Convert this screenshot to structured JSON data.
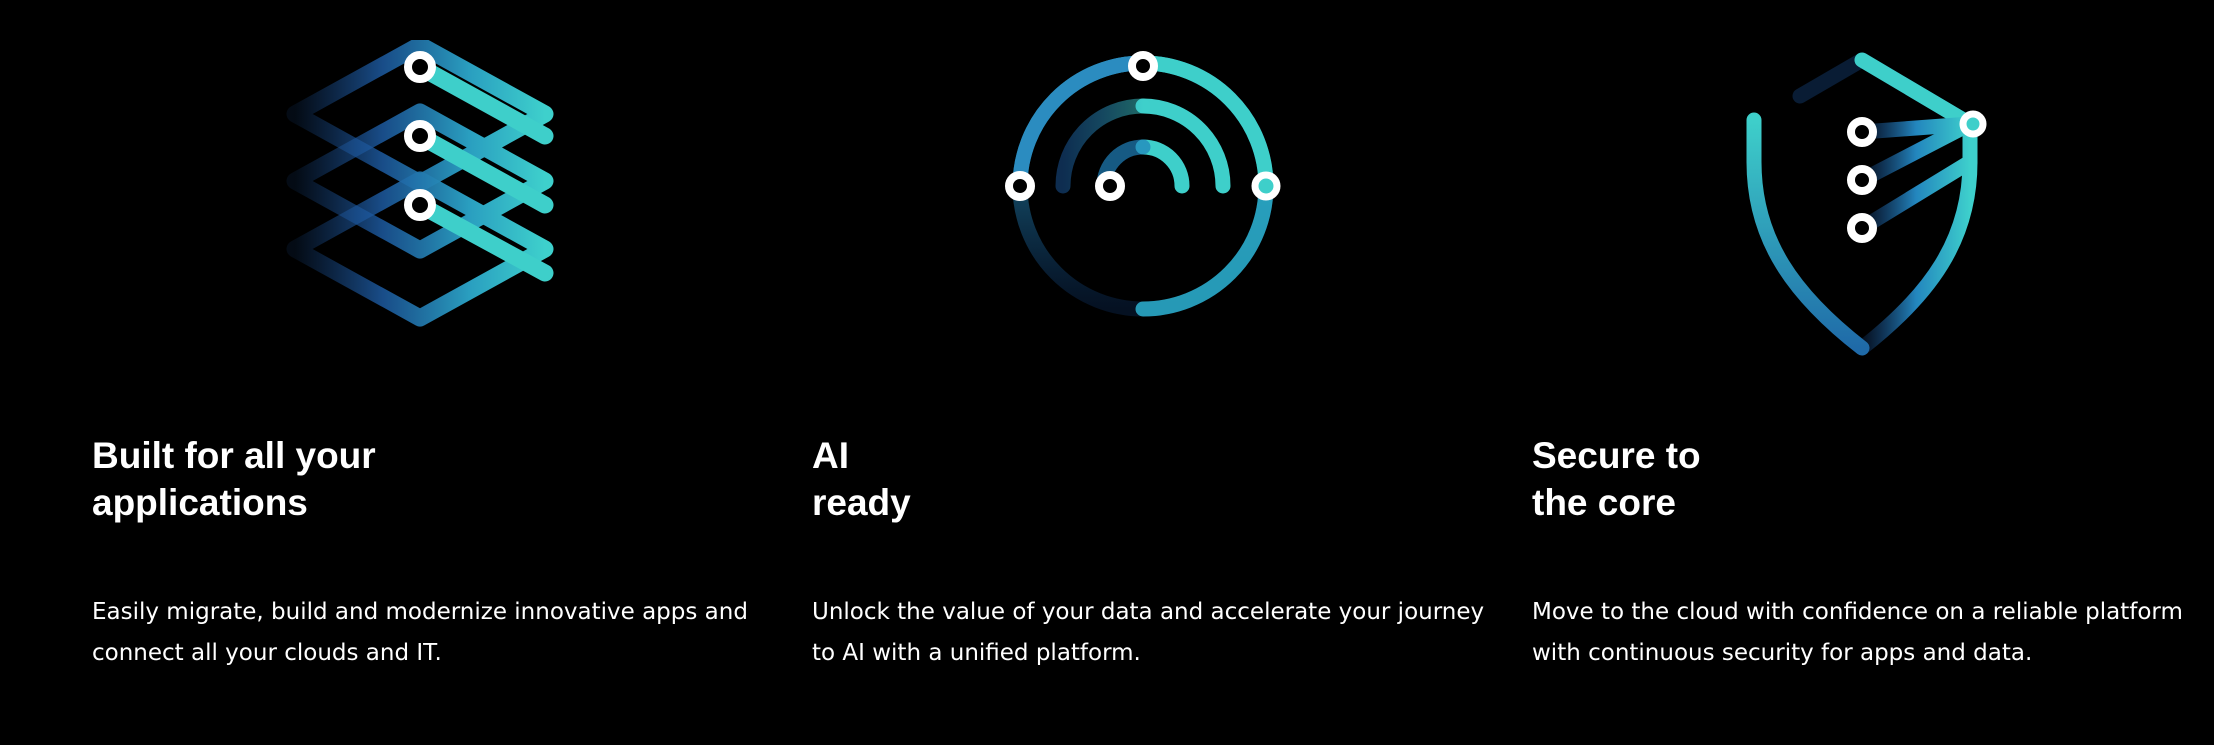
{
  "colors": {
    "background": "#000000",
    "text": "#ffffff",
    "accent_teal": "#3ccfcf",
    "accent_blue": "#1f5fa8"
  },
  "features": [
    {
      "icon": "stacked-layers-icon",
      "title_lines": [
        "Built for all your",
        "applications"
      ],
      "description_lines": [
        "Easily migrate, build and modernize innovative apps and",
        "connect all your clouds and IT."
      ]
    },
    {
      "icon": "concentric-arcs-icon",
      "title_lines": [
        "AI",
        "ready"
      ],
      "description_lines": [
        "Unlock the value of your data and accelerate your journey",
        "to AI with a unified platform."
      ]
    },
    {
      "icon": "shield-icon",
      "title_lines": [
        "Secure to",
        "the core"
      ],
      "description_lines": [
        "Move to the cloud with confidence on a reliable platform",
        "with continuous security for apps and data."
      ]
    }
  ]
}
